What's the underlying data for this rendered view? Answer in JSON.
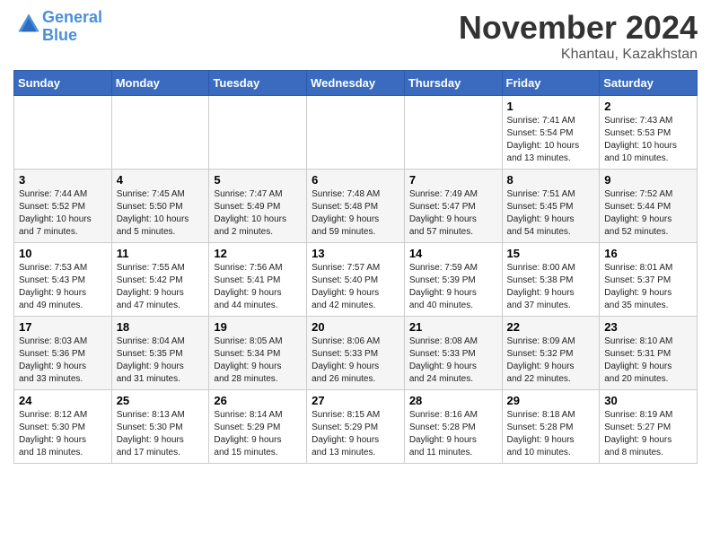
{
  "header": {
    "logo_line1": "General",
    "logo_line2": "Blue",
    "month": "November 2024",
    "location": "Khantau, Kazakhstan"
  },
  "weekdays": [
    "Sunday",
    "Monday",
    "Tuesday",
    "Wednesday",
    "Thursday",
    "Friday",
    "Saturday"
  ],
  "weeks": [
    [
      {
        "day": "",
        "info": ""
      },
      {
        "day": "",
        "info": ""
      },
      {
        "day": "",
        "info": ""
      },
      {
        "day": "",
        "info": ""
      },
      {
        "day": "",
        "info": ""
      },
      {
        "day": "1",
        "info": "Sunrise: 7:41 AM\nSunset: 5:54 PM\nDaylight: 10 hours\nand 13 minutes."
      },
      {
        "day": "2",
        "info": "Sunrise: 7:43 AM\nSunset: 5:53 PM\nDaylight: 10 hours\nand 10 minutes."
      }
    ],
    [
      {
        "day": "3",
        "info": "Sunrise: 7:44 AM\nSunset: 5:52 PM\nDaylight: 10 hours\nand 7 minutes."
      },
      {
        "day": "4",
        "info": "Sunrise: 7:45 AM\nSunset: 5:50 PM\nDaylight: 10 hours\nand 5 minutes."
      },
      {
        "day": "5",
        "info": "Sunrise: 7:47 AM\nSunset: 5:49 PM\nDaylight: 10 hours\nand 2 minutes."
      },
      {
        "day": "6",
        "info": "Sunrise: 7:48 AM\nSunset: 5:48 PM\nDaylight: 9 hours\nand 59 minutes."
      },
      {
        "day": "7",
        "info": "Sunrise: 7:49 AM\nSunset: 5:47 PM\nDaylight: 9 hours\nand 57 minutes."
      },
      {
        "day": "8",
        "info": "Sunrise: 7:51 AM\nSunset: 5:45 PM\nDaylight: 9 hours\nand 54 minutes."
      },
      {
        "day": "9",
        "info": "Sunrise: 7:52 AM\nSunset: 5:44 PM\nDaylight: 9 hours\nand 52 minutes."
      }
    ],
    [
      {
        "day": "10",
        "info": "Sunrise: 7:53 AM\nSunset: 5:43 PM\nDaylight: 9 hours\nand 49 minutes."
      },
      {
        "day": "11",
        "info": "Sunrise: 7:55 AM\nSunset: 5:42 PM\nDaylight: 9 hours\nand 47 minutes."
      },
      {
        "day": "12",
        "info": "Sunrise: 7:56 AM\nSunset: 5:41 PM\nDaylight: 9 hours\nand 44 minutes."
      },
      {
        "day": "13",
        "info": "Sunrise: 7:57 AM\nSunset: 5:40 PM\nDaylight: 9 hours\nand 42 minutes."
      },
      {
        "day": "14",
        "info": "Sunrise: 7:59 AM\nSunset: 5:39 PM\nDaylight: 9 hours\nand 40 minutes."
      },
      {
        "day": "15",
        "info": "Sunrise: 8:00 AM\nSunset: 5:38 PM\nDaylight: 9 hours\nand 37 minutes."
      },
      {
        "day": "16",
        "info": "Sunrise: 8:01 AM\nSunset: 5:37 PM\nDaylight: 9 hours\nand 35 minutes."
      }
    ],
    [
      {
        "day": "17",
        "info": "Sunrise: 8:03 AM\nSunset: 5:36 PM\nDaylight: 9 hours\nand 33 minutes."
      },
      {
        "day": "18",
        "info": "Sunrise: 8:04 AM\nSunset: 5:35 PM\nDaylight: 9 hours\nand 31 minutes."
      },
      {
        "day": "19",
        "info": "Sunrise: 8:05 AM\nSunset: 5:34 PM\nDaylight: 9 hours\nand 28 minutes."
      },
      {
        "day": "20",
        "info": "Sunrise: 8:06 AM\nSunset: 5:33 PM\nDaylight: 9 hours\nand 26 minutes."
      },
      {
        "day": "21",
        "info": "Sunrise: 8:08 AM\nSunset: 5:33 PM\nDaylight: 9 hours\nand 24 minutes."
      },
      {
        "day": "22",
        "info": "Sunrise: 8:09 AM\nSunset: 5:32 PM\nDaylight: 9 hours\nand 22 minutes."
      },
      {
        "day": "23",
        "info": "Sunrise: 8:10 AM\nSunset: 5:31 PM\nDaylight: 9 hours\nand 20 minutes."
      }
    ],
    [
      {
        "day": "24",
        "info": "Sunrise: 8:12 AM\nSunset: 5:30 PM\nDaylight: 9 hours\nand 18 minutes."
      },
      {
        "day": "25",
        "info": "Sunrise: 8:13 AM\nSunset: 5:30 PM\nDaylight: 9 hours\nand 17 minutes."
      },
      {
        "day": "26",
        "info": "Sunrise: 8:14 AM\nSunset: 5:29 PM\nDaylight: 9 hours\nand 15 minutes."
      },
      {
        "day": "27",
        "info": "Sunrise: 8:15 AM\nSunset: 5:29 PM\nDaylight: 9 hours\nand 13 minutes."
      },
      {
        "day": "28",
        "info": "Sunrise: 8:16 AM\nSunset: 5:28 PM\nDaylight: 9 hours\nand 11 minutes."
      },
      {
        "day": "29",
        "info": "Sunrise: 8:18 AM\nSunset: 5:28 PM\nDaylight: 9 hours\nand 10 minutes."
      },
      {
        "day": "30",
        "info": "Sunrise: 8:19 AM\nSunset: 5:27 PM\nDaylight: 9 hours\nand 8 minutes."
      }
    ]
  ]
}
